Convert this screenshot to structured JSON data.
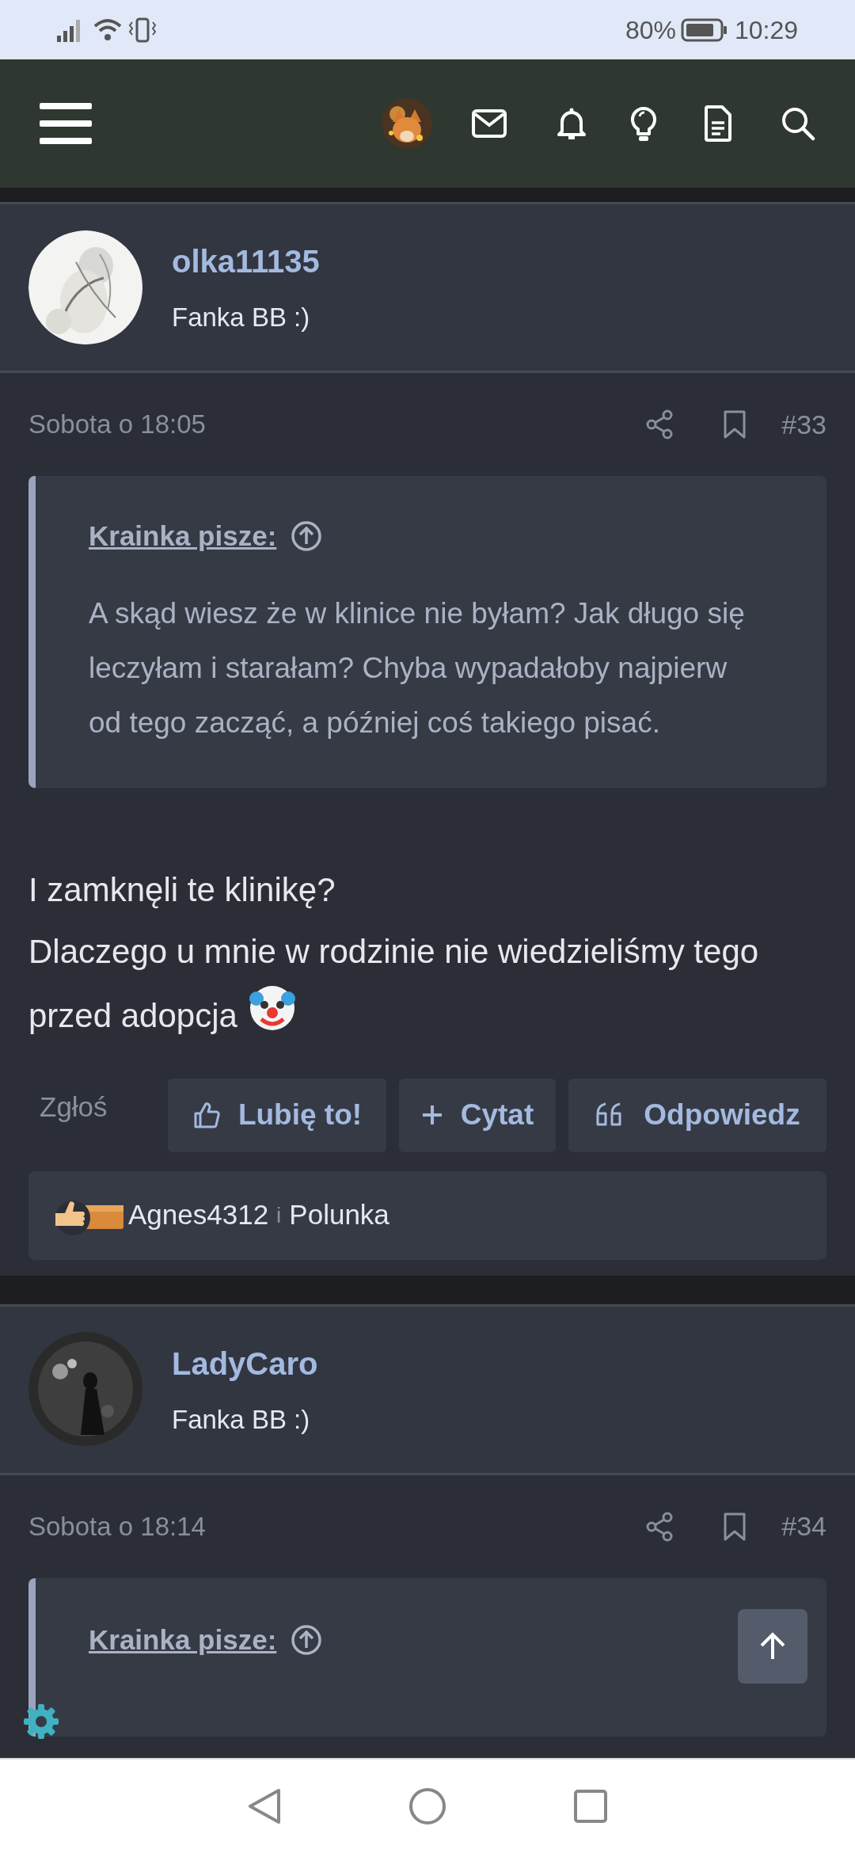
{
  "status_bar": {
    "battery": "80%",
    "time": "10:29"
  },
  "posts": [
    {
      "username": "olka11135",
      "user_title": "Fanka BB :)",
      "date": "Sobota o 18:05",
      "number": "#33",
      "quote": {
        "author": "Krainka pisze:",
        "text": "A skąd wiesz że w klinice nie byłam? Jak długo się leczyłam i starałam? Chyba wypadałoby najpierw od tego zacząć, a później coś takiego pisać."
      },
      "message": [
        "I zamknęli te klinikę?",
        "Dlaczego u mnie w rodzinie nie wiedzieliśmy tego przed adopcja"
      ],
      "report": "Zgłoś",
      "buttons": [
        {
          "kind": "like",
          "label": "Lubię to!"
        },
        {
          "kind": "quote",
          "label": "Cytat"
        },
        {
          "kind": "reply",
          "label": "Odpowiedz"
        }
      ],
      "reactions": {
        "users": [
          "Agnes4312",
          "Polunka"
        ],
        "joiner": "i"
      }
    },
    {
      "username": "LadyCaro",
      "user_title": "Fanka BB :)",
      "date": "Sobota o 18:14",
      "number": "#34",
      "quote": {
        "author": "Krainka pisze:"
      }
    }
  ]
}
